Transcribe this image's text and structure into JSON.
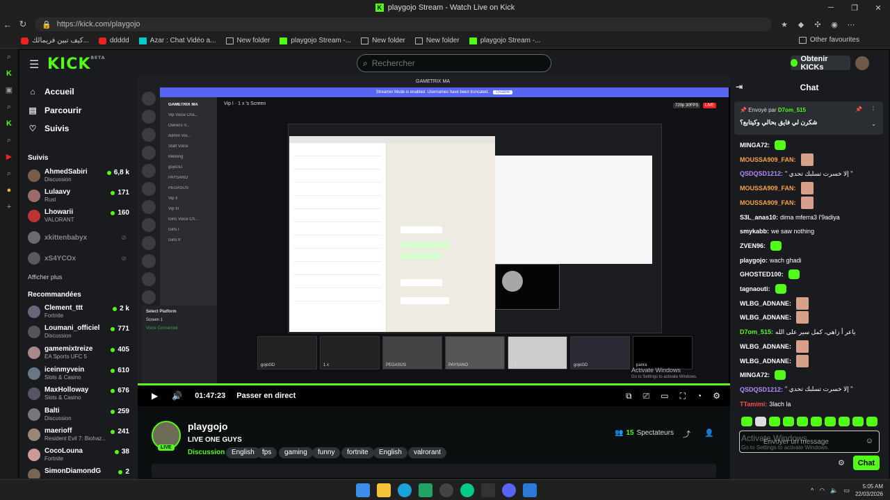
{
  "browser": {
    "window_title": "playgojo Stream - Watch Live on Kick",
    "url": "https://kick.com/playgojo",
    "bookmarks": [
      "كيف تبين فريمالك...",
      "ddddd",
      "Azar : Chat Vidéo a...",
      "New folder",
      "playgojo Stream -...",
      "New folder",
      "New folder",
      "playgojo Stream -..."
    ],
    "other_favourites": "Other favourites"
  },
  "kick": {
    "logo": "KICK",
    "logo_sup": "BETA",
    "search_placeholder": "Rechercher",
    "obtenir": "Obtenir KICKs"
  },
  "nav": {
    "accueil": "Accueil",
    "parcourir": "Parcourir",
    "suivis": "Suivis"
  },
  "followed_title": "Suivis",
  "followed": [
    {
      "name": "AhmedSabiri",
      "cat": "Discussion",
      "viewers": "6,8 k",
      "color": "#7a5c4a"
    },
    {
      "name": "Lulaavy",
      "cat": "Rust",
      "viewers": "171",
      "color": "#9a6b6b"
    },
    {
      "name": "Lhowarii",
      "cat": "VALORANT",
      "viewers": "160",
      "color": "#b33"
    }
  ],
  "offline": [
    {
      "name": "xkittenbabyx",
      "color": "#bbb"
    },
    {
      "name": "xS4YCOx",
      "color": "#999"
    }
  ],
  "afficher_plus": "Afficher plus",
  "recommended_title": "Recommandées",
  "recommended": [
    {
      "name": "Clement_ttt",
      "cat": "Fortnite",
      "viewers": "2 k",
      "color": "#667"
    },
    {
      "name": "Loumani_officiel",
      "cat": "Discussion",
      "viewers": "771",
      "color": "#555"
    },
    {
      "name": "gamemixtreize",
      "cat": "EA Sports UFC 5",
      "viewers": "405",
      "color": "#a88"
    },
    {
      "name": "iceinmyvein",
      "cat": "Slots & Casino",
      "viewers": "610",
      "color": "#678"
    },
    {
      "name": "MaxHolloway",
      "cat": "Slots & Casino",
      "viewers": "676",
      "color": "#556"
    },
    {
      "name": "Balti",
      "cat": "Discussion",
      "viewers": "259",
      "color": "#777"
    },
    {
      "name": "maerioff",
      "cat": "Resident Evil 7: Biohaz...",
      "viewers": "241",
      "color": "#987"
    },
    {
      "name": "CocoLouna",
      "cat": "Fortnite",
      "viewers": "38",
      "color": "#c99"
    },
    {
      "name": "SimonDiamondG",
      "cat": "",
      "viewers": "2",
      "color": "#765"
    }
  ],
  "player": {
    "time": "01:47:23",
    "live_text": "Passer en direct",
    "discord_title": "GAMETRIX MA",
    "streamer_mode": "Streamer Mode is enabled. Usernames have been truncated.",
    "disable": "Disable",
    "channel_header": "Vip I · 1 x 's Screen",
    "quality": "720p 30FPS",
    "quality_live": "LIVE",
    "discord_channels": [
      "GAMETRIX MA",
      "Vip Voice Cha...",
      "Owners V...",
      "Admin Voi...",
      "Staff Voice",
      "Meeting",
      "gojoGD",
      "PAYSANO",
      "PEGASUS",
      "Vip II",
      "Vip III",
      "Girls Voice Ch...",
      "Girls I",
      "Girls II"
    ],
    "discord_bottom": [
      "Select Platform",
      "Screen 1",
      "Voice Connected"
    ],
    "thumbs": [
      "gojoGD",
      "1 x",
      "PEGASUS",
      "PAYSANO",
      "1 x",
      "gojoGD",
      "panra"
    ],
    "watermark": "Activate Windows",
    "watermark_sub": "Go to Settings to activate Windows."
  },
  "stream": {
    "channel": "playgojo",
    "live_badge": "LIVE",
    "title": "LIVE ONE GUYS",
    "category": "Discussion",
    "tags": [
      "English",
      "fps",
      "gaming",
      "funny",
      "fortnite",
      "English",
      "valrorant"
    ],
    "viewers": "15",
    "viewers_label": "Spectateurs"
  },
  "chat": {
    "title": "Chat",
    "pinned_by": "Envoyé par",
    "pinned_user": "D7om_515",
    "pinned_text": "شكرن لي فايق بحالي وكيتابع؟",
    "messages": [
      {
        "user": "MINGA72:",
        "text": "",
        "color": "#ffffff",
        "emote": "green"
      },
      {
        "user": "MOUSSA909_FAN:",
        "text": "",
        "color": "#f9a34b",
        "emote": "face"
      },
      {
        "user": "QSDQSD1212:",
        "text": "\" إلا خسرت تسلبك تحدي \"",
        "color": "#b48cff",
        "emote": ""
      },
      {
        "user": "MOUSSA909_FAN:",
        "text": "",
        "color": "#f9a34b",
        "emote": "face"
      },
      {
        "user": "MOUSSA909_FAN:",
        "text": "",
        "color": "#f9a34b",
        "emote": "face"
      },
      {
        "user": "S3L_anas10:",
        "text": "dima mferra3 l'9adiya",
        "color": "#ffffff",
        "emote": ""
      },
      {
        "user": "smykabb:",
        "text": "we saw nothing",
        "color": "#ffffff",
        "emote": ""
      },
      {
        "user": "ZVEN96:",
        "text": "",
        "color": "#ffffff",
        "emote": "green"
      },
      {
        "user": "playgojo:",
        "text": "wach ghadi",
        "color": "#ffffff",
        "emote": ""
      },
      {
        "user": "GHOSTED100:",
        "text": "",
        "color": "#ffffff",
        "emote": "green"
      },
      {
        "user": "tagnaouti:",
        "text": "",
        "color": "#ffffff",
        "emote": "green"
      },
      {
        "user": "WLBG_ADNANE:",
        "text": "",
        "color": "#ffffff",
        "emote": "face"
      },
      {
        "user": "WLBG_ADNANE:",
        "text": "",
        "color": "#ffffff",
        "emote": "face"
      },
      {
        "user": "D7om_515:",
        "text": "ياعر أ زاهي، كمل سير على الله",
        "color": "#53fc18",
        "emote": ""
      },
      {
        "user": "WLBG_ADNANE:",
        "text": "",
        "color": "#ffffff",
        "emote": "face"
      },
      {
        "user": "WLBG_ADNANE:",
        "text": "",
        "color": "#ffffff",
        "emote": "face"
      },
      {
        "user": "MINGA72:",
        "text": "",
        "color": "#ffffff",
        "emote": "green"
      },
      {
        "user": "QSDQSD1212:",
        "text": "\" إلا خسرت تسلبك تحدي \"",
        "color": "#b48cff",
        "emote": ""
      },
      {
        "user": "TTamimi:",
        "text": "3lach la",
        "color": "#ff4d4d",
        "emote": ""
      }
    ],
    "input_placeholder": "Envoyer un message",
    "send": "Chat",
    "watermark": "Activate Windows",
    "watermark_sub": "Go to Settings to activate Windows."
  },
  "taskbar": {
    "time": "5:05 AM",
    "date": "22/03/2026"
  }
}
